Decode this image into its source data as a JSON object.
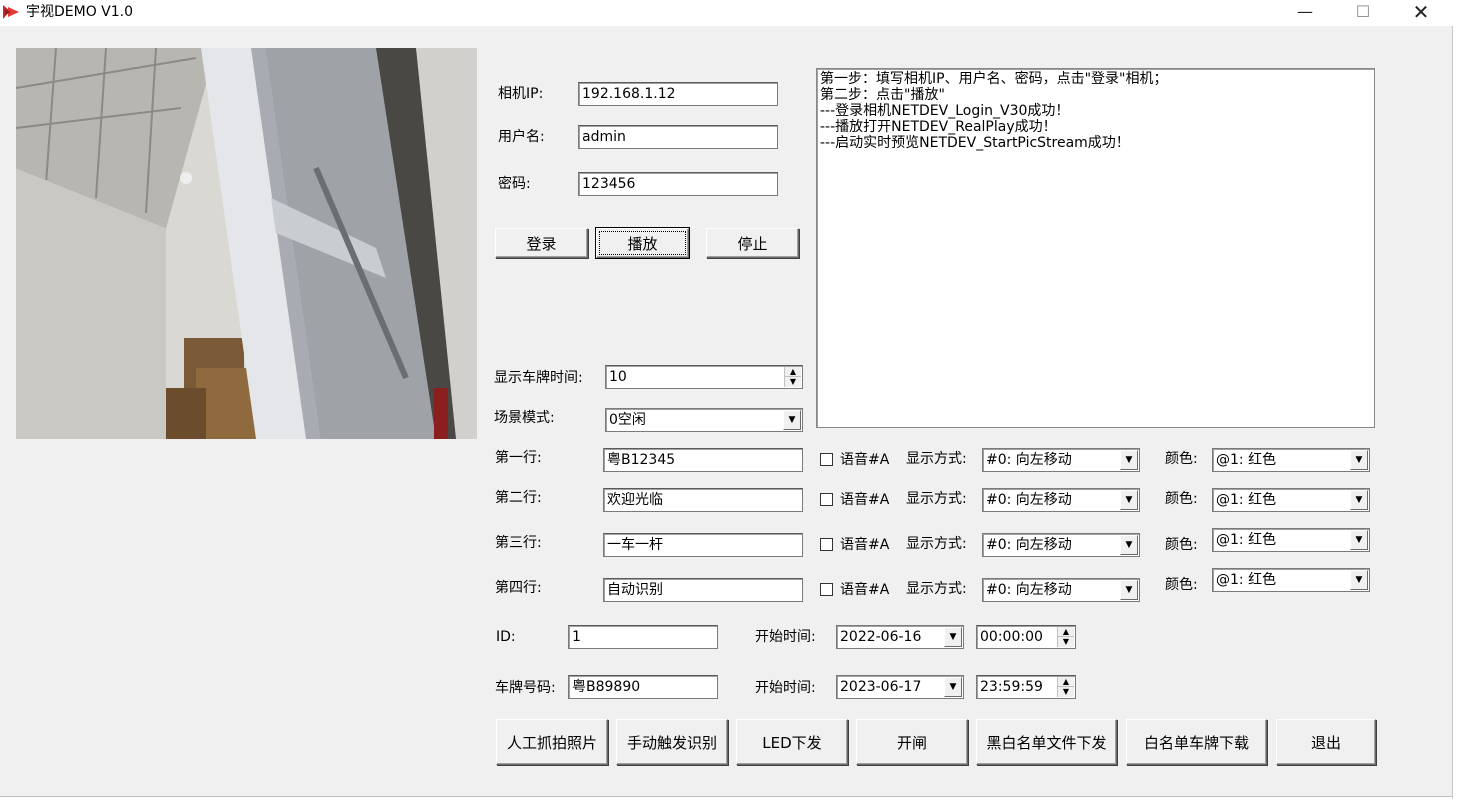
{
  "window": {
    "title": "宇视DEMO  V1.0",
    "min_glyph": "—",
    "max_glyph": "☐",
    "close_glyph": "✕"
  },
  "camera": {
    "ip_label": "相机IP:",
    "ip_value": "192.168.1.12",
    "user_label": "用户名:",
    "user_value": "admin",
    "password_label": "密码:",
    "password_value": "123456"
  },
  "buttons": {
    "login": "登录",
    "play": "播放",
    "stop": "停止",
    "manual_capture": "人工抓拍照片",
    "manual_trigger": "手动触发识别",
    "led_send": "LED下发",
    "open_gate": "开闸",
    "blackwhite_send": "黑白名单文件下发",
    "whitelist_download": "白名单车牌下载",
    "exit": "退出"
  },
  "log": [
    "第一步：填写相机IP、用户名、密码，点击\"登录\"相机；",
    "第二步：点击\"播放\"",
    "---登录相机NETDEV_Login_V30成功！",
    "---播放打开NETDEV_RealPlay成功！",
    "---启动实时预览NETDEV_StartPicStream成功！"
  ],
  "display_time": {
    "label": "显示车牌时间:",
    "value": "10"
  },
  "scene": {
    "label": "场景模式:",
    "value": "0空闲"
  },
  "rows": [
    {
      "label": "第一行:",
      "text": "粤B12345",
      "voice": "语音#A",
      "mode_label": "显示方式:",
      "mode": "#0: 向左移动",
      "color_label": "颜色:",
      "color": "@1: 红色"
    },
    {
      "label": "第二行:",
      "text": "欢迎光临",
      "voice": "语音#A",
      "mode_label": "显示方式:",
      "mode": "#0: 向左移动",
      "color_label": "颜色:",
      "color": "@1: 红色"
    },
    {
      "label": "第三行:",
      "text": "一车一杆",
      "voice": "语音#A",
      "mode_label": "显示方式:",
      "mode": "#0: 向左移动",
      "color_label": "颜色:",
      "color": "@1: 红色"
    },
    {
      "label": "第四行:",
      "text": "自动识别",
      "voice": "语音#A",
      "mode_label": "显示方式:",
      "mode": "#0: 向左移动",
      "color_label": "颜色:",
      "color": "@1: 红色"
    }
  ],
  "id_field": {
    "label": "ID:",
    "value": "1"
  },
  "plate_field": {
    "label": "车牌号码:",
    "value": "粤B89890"
  },
  "start_time_1": {
    "label": "开始时间:",
    "date": "2022-06-16",
    "time": "00:00:00"
  },
  "start_time_2": {
    "label": "开始时间:",
    "date": "2023-06-17",
    "time": "23:59:59"
  },
  "icons": {
    "dropdown": "▼",
    "spin_up": "▲",
    "spin_down": "▼"
  }
}
